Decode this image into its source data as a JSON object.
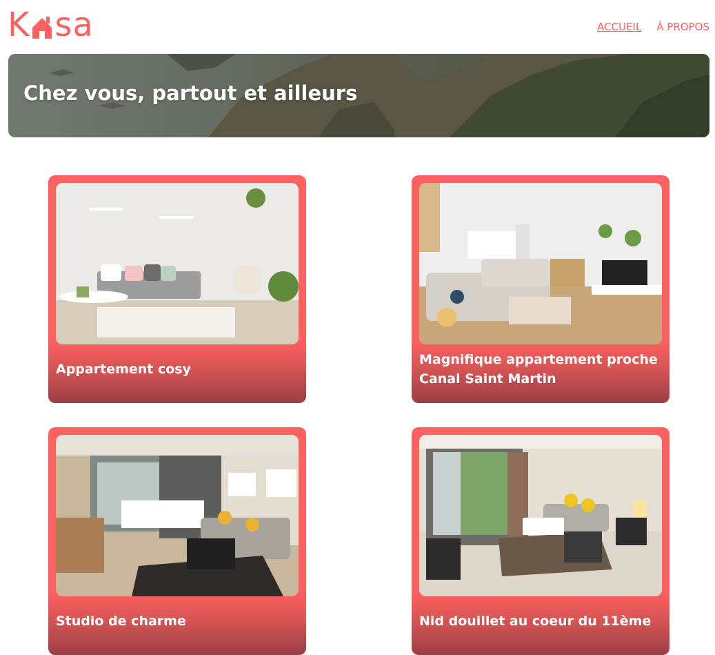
{
  "logo": {
    "part_1": "K",
    "part_2": "sa",
    "icon": "house-icon",
    "color": "#FF6060"
  },
  "nav": {
    "home": "ACCUEIL",
    "about": "À PROPOS"
  },
  "banner": {
    "title": "Chez vous, partout et ailleurs"
  },
  "listings": [
    {
      "title": "Appartement cosy"
    },
    {
      "title": "Magnifique appartement proche Canal Saint Martin"
    },
    {
      "title": "Studio de charme"
    },
    {
      "title": "Nid douillet au coeur du 11ème"
    }
  ],
  "colors": {
    "accent": "#FF6060",
    "text_on_accent": "#FFFFFF"
  }
}
